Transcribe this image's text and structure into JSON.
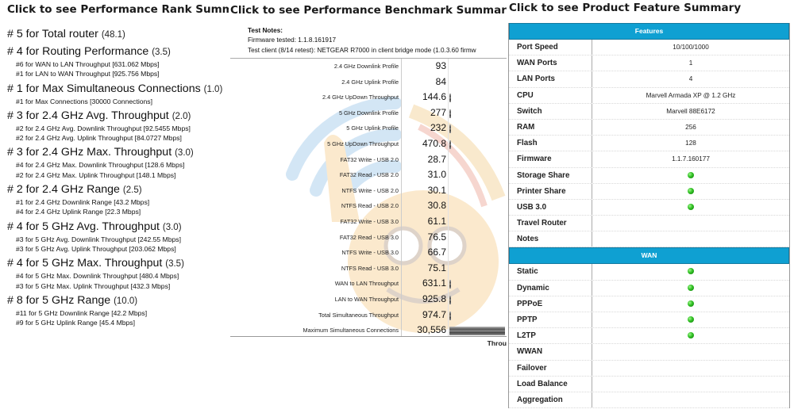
{
  "rank_summary": {
    "title": "Click to see Performance Rank Summary",
    "groups": [
      {
        "label": "# 5 for Total router",
        "score": "(48.1)",
        "details": []
      },
      {
        "label": "# 4 for Routing Performance",
        "score": "(3.5)",
        "details": [
          "#6 for WAN to LAN Throughput [631.062 Mbps]",
          "#1 for LAN to WAN Throughput [925.756 Mbps]"
        ]
      },
      {
        "label": "# 1 for Max Simultaneous Connections",
        "score": "(1.0)",
        "details": [
          "#1 for Max Connections [30000 Connections]"
        ]
      },
      {
        "label": "# 3 for 2.4 GHz Avg. Throughput",
        "score": "(2.0)",
        "details": [
          "#2 for 2.4 GHz Avg. Downlink Throughput [92.5455 Mbps]",
          "#2 for 2.4 GHz Avg. Uplink Throughput [84.0727 Mbps]"
        ]
      },
      {
        "label": "# 3 for 2.4 GHz Max. Throughput",
        "score": "(3.0)",
        "details": [
          "#4 for 2.4 GHz Max. Downlink Throughput [128.6 Mbps]",
          "#2 for 2.4 GHz Max. Uplink Throughput [148.1 Mbps]"
        ]
      },
      {
        "label": "# 2 for 2.4 GHz Range",
        "score": "(2.5)",
        "details": [
          "#1 for 2.4 GHz Downlink Range [43.2 Mbps]",
          "#4 for 2.4 GHz Uplink Range [22.3 Mbps]"
        ]
      },
      {
        "label": "# 4 for 5 GHz Avg. Throughput",
        "score": "(3.0)",
        "details": [
          "#3 for 5 GHz Avg. Downlink Throughput [242.55 Mbps]",
          "#3 for 5 GHz Avg. Uplink Throughput [203.062 Mbps]"
        ]
      },
      {
        "label": "# 4 for 5 GHz Max. Throughput",
        "score": "(3.5)",
        "details": [
          "#4 for 5 GHz Max. Downlink Throughput [480.4 Mbps]",
          "#3 for 5 GHz Max. Uplink Throughput [432.3 Mbps]"
        ]
      },
      {
        "label": "# 8 for 5 GHz Range",
        "score": "(10.0)",
        "details": [
          "#11 for 5 GHz Downlink Range [42.2 Mbps]",
          "#9 for 5 GHz Uplink Range [45.4 Mbps]"
        ]
      }
    ]
  },
  "benchmark_summary": {
    "title": "Click to see Performance Benchmark Summary",
    "notes_title": "Test Notes:",
    "firmware_line": "Firmware tested: 1.1.8.161917",
    "client_line": "Test client (8/14 retest): NETGEAR R7000 in client bridge mode (1.0.3.60 firmw",
    "footer": "Throu",
    "rows": [
      {
        "label": "2.4 GHz Downlink Profile",
        "value": "93",
        "bar_fraction": 0
      },
      {
        "label": "2.4 GHz Uplink Profile",
        "value": "84",
        "bar_fraction": 0
      },
      {
        "label": "2.4 GHz UpDown Throughput",
        "value": "144.6",
        "bar_fraction": 0.004
      },
      {
        "label": "5 GHz Downlink Profile",
        "value": "277",
        "bar_fraction": 0.005
      },
      {
        "label": "5 GHz Uplink Profile",
        "value": "232",
        "bar_fraction": 0.005
      },
      {
        "label": "5 GHz UpDown Throughput",
        "value": "470.8",
        "bar_fraction": 0.008
      },
      {
        "label": "FAT32 Write - USB 2.0",
        "value": "28.7",
        "bar_fraction": 0
      },
      {
        "label": "FAT32 Read - USB 2.0",
        "value": "31.0",
        "bar_fraction": 0
      },
      {
        "label": "NTFS Write - USB 2.0",
        "value": "30.1",
        "bar_fraction": 0
      },
      {
        "label": "NTFS Read - USB 2.0",
        "value": "30.8",
        "bar_fraction": 0
      },
      {
        "label": "FAT32 Write - USB 3.0",
        "value": "61.1",
        "bar_fraction": 0
      },
      {
        "label": "FAT32 Read - USB 3.0",
        "value": "76.5",
        "bar_fraction": 0
      },
      {
        "label": "NTFS Write - USB 3.0",
        "value": "66.7",
        "bar_fraction": 0
      },
      {
        "label": "NTFS Read - USB 3.0",
        "value": "75.1",
        "bar_fraction": 0
      },
      {
        "label": "WAN to LAN Throughput",
        "value": "631.1",
        "bar_fraction": 0.02
      },
      {
        "label": "LAN to WAN Throughput",
        "value": "925.8",
        "bar_fraction": 0.03
      },
      {
        "label": "Total Simultaneous Throughput",
        "value": "974.7",
        "bar_fraction": 0.032
      },
      {
        "label": "Maximum Simultaneous Connections",
        "value": "30,556",
        "bar_fraction": 1.0
      }
    ]
  },
  "feature_summary": {
    "title": "Click to see Product Feature Summary",
    "indicator_color": "#2fbf22",
    "header_color": "#0fa0d2",
    "sections": [
      {
        "header": "Features",
        "rows": [
          {
            "name": "Port Speed",
            "value": "10/100/1000",
            "check": false
          },
          {
            "name": "WAN Ports",
            "value": "1",
            "check": false
          },
          {
            "name": "LAN Ports",
            "value": "4",
            "check": false
          },
          {
            "name": "CPU",
            "value": "Marvell Armada XP @ 1.2 GHz",
            "check": false
          },
          {
            "name": "Switch",
            "value": "Marvell 88E6172",
            "check": false
          },
          {
            "name": "RAM",
            "value": "256",
            "check": false
          },
          {
            "name": "Flash",
            "value": "128",
            "check": false
          },
          {
            "name": "Firmware",
            "value": "1.1.7.160177",
            "check": false
          },
          {
            "name": "Storage Share",
            "value": "",
            "check": true
          },
          {
            "name": "Printer Share",
            "value": "",
            "check": true
          },
          {
            "name": "USB 3.0",
            "value": "",
            "check": true
          },
          {
            "name": "Travel Router",
            "value": "",
            "check": false
          },
          {
            "name": "Notes",
            "value": "",
            "check": false
          }
        ]
      },
      {
        "header": "WAN",
        "rows": [
          {
            "name": "Static",
            "value": "",
            "check": true
          },
          {
            "name": "Dynamic",
            "value": "",
            "check": true
          },
          {
            "name": "PPPoE",
            "value": "",
            "check": true
          },
          {
            "name": "PPTP",
            "value": "",
            "check": true
          },
          {
            "name": "L2TP",
            "value": "",
            "check": true
          },
          {
            "name": "WWAN",
            "value": "",
            "check": false
          },
          {
            "name": "Failover",
            "value": "",
            "check": false
          },
          {
            "name": "Load Balance",
            "value": "",
            "check": false
          },
          {
            "name": "Aggregation",
            "value": "",
            "check": false
          }
        ]
      }
    ]
  }
}
